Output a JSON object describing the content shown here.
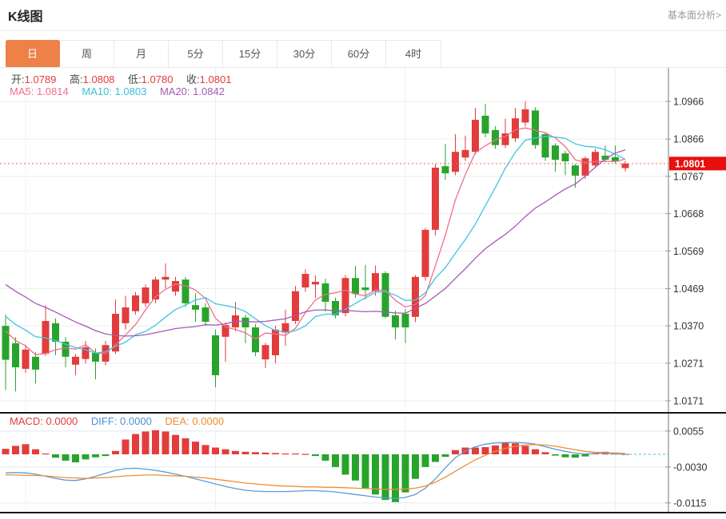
{
  "header": {
    "title": "K线图",
    "link_label": "基本面分析>"
  },
  "tabs": {
    "active_index": 0,
    "items": [
      "日",
      "周",
      "月",
      "5分",
      "15分",
      "30分",
      "60分",
      "4时"
    ]
  },
  "readout": {
    "open_label": "开:",
    "open": "1.0789",
    "high_label": "高:",
    "high": "1.0808",
    "low_label": "低:",
    "low": "1.0780",
    "close_label": "收:",
    "close": "1.0801",
    "ma5_label": "MA5:",
    "ma5": "1.0814",
    "ma10_label": "MA10:",
    "ma10": "1.0803",
    "ma20_label": "MA20:",
    "ma20": "1.0842"
  },
  "macd_readout": {
    "macd_label": "MACD:",
    "macd": "0.0000",
    "diff_label": "DIFF:",
    "diff": "0.0000",
    "dea_label": "DEA:",
    "dea": "0.0000"
  },
  "colors": {
    "accent_orange": "#ee8147",
    "up_red": "#e23c3c",
    "down_green": "#28a42c",
    "ma5_pink": "#f06d8c",
    "ma10_cyan": "#3ec6dd",
    "ma20_purple": "#a55ab4",
    "diff_blue": "#5b9bd8",
    "dea_orange": "#ee8f33",
    "price_badge_red": "#e80f0f",
    "grid": "#ededed",
    "macd_grid": "#dfeaf2",
    "axis_text": "#333333"
  },
  "chart_data": {
    "type": "candlestick+macd",
    "main": {
      "y_axis": [
        "1.0966",
        "1.0866",
        "1.0767",
        "1.0668",
        "1.0569",
        "1.0469",
        "1.0370",
        "1.0271",
        "1.0171"
      ],
      "current_price": 1.0801,
      "current_price_label": "1.0801",
      "time_gridline_indices": [
        2,
        21,
        40,
        61
      ],
      "ma_lines": [
        {
          "period": 5,
          "color": "#f06d8c"
        },
        {
          "period": 10,
          "color": "#3ec6dd"
        },
        {
          "period": 20,
          "color": "#a55ab4"
        }
      ],
      "ma_seed_closes": [
        1.062,
        1.0615,
        1.061,
        1.06,
        1.059,
        1.0575,
        1.056,
        1.0545,
        1.053,
        1.0515,
        1.0498,
        1.0478,
        1.0455,
        1.0432,
        1.0412,
        1.0396,
        1.0385,
        1.0378,
        1.0372,
        1.0366
      ],
      "candles_ohlc": [
        [
          1.037,
          1.04,
          1.02,
          1.028
        ],
        [
          1.0324,
          1.034,
          1.0196,
          1.026
        ],
        [
          1.0256,
          1.032,
          1.0245,
          1.0307
        ],
        [
          1.0288,
          1.03,
          1.0217,
          1.0254
        ],
        [
          1.0296,
          1.0425,
          1.029,
          1.0383
        ],
        [
          1.0377,
          1.039,
          1.0292,
          1.0328
        ],
        [
          1.0328,
          1.034,
          1.026,
          1.0288
        ],
        [
          1.0267,
          1.0295,
          1.0239,
          1.0288
        ],
        [
          1.0282,
          1.033,
          1.027,
          1.0313
        ],
        [
          1.0298,
          1.031,
          1.0228,
          1.0275
        ],
        [
          1.0275,
          1.033,
          1.0265,
          1.0319
        ],
        [
          1.0302,
          1.044,
          1.0295,
          1.0402
        ],
        [
          1.0377,
          1.045,
          1.036,
          1.0419
        ],
        [
          1.0409,
          1.046,
          1.04,
          1.0451
        ],
        [
          1.043,
          1.048,
          1.042,
          1.0472
        ],
        [
          1.044,
          1.05,
          1.043,
          1.0493
        ],
        [
          1.0493,
          1.0536,
          1.047,
          1.05
        ],
        [
          1.0461,
          1.05,
          1.045,
          1.0489
        ],
        [
          1.0493,
          1.05,
          1.042,
          1.043
        ],
        [
          1.0425,
          1.0457,
          1.0381,
          1.0413
        ],
        [
          1.0419,
          1.043,
          1.037,
          1.0381
        ],
        [
          1.0345,
          1.036,
          1.0207,
          1.0239
        ],
        [
          1.0341,
          1.038,
          1.0275,
          1.0372
        ],
        [
          1.0366,
          1.0434,
          1.0355,
          1.0398
        ],
        [
          1.0392,
          1.04,
          1.0324,
          1.0366
        ],
        [
          1.0366,
          1.0375,
          1.029,
          1.03
        ],
        [
          1.0281,
          1.0325,
          1.0258,
          1.0319
        ],
        [
          1.0292,
          1.037,
          1.0271,
          1.036
        ],
        [
          1.0352,
          1.0413,
          1.0317,
          1.0377
        ],
        [
          1.0383,
          1.0476,
          1.0375,
          1.0462
        ],
        [
          1.0472,
          1.052,
          1.046,
          1.0508
        ],
        [
          1.048,
          1.0504,
          1.0444,
          1.0487
        ],
        [
          1.0483,
          1.0495,
          1.0408,
          1.0434
        ],
        [
          1.0436,
          1.0445,
          1.039,
          1.0398
        ],
        [
          1.0404,
          1.0505,
          1.0395,
          1.0497
        ],
        [
          1.0497,
          1.0529,
          1.0445,
          1.0455
        ],
        [
          1.0472,
          1.0532,
          1.044,
          1.0465
        ],
        [
          1.0462,
          1.053,
          1.045,
          1.051
        ],
        [
          1.051,
          1.0515,
          1.039,
          1.0394
        ],
        [
          1.0398,
          1.041,
          1.0334,
          1.0366
        ],
        [
          1.0402,
          1.0415,
          1.0324,
          1.0366
        ],
        [
          1.0394,
          1.0505,
          1.038,
          1.05
        ],
        [
          1.05,
          1.063,
          1.049,
          1.0625
        ],
        [
          1.0625,
          1.08,
          1.061,
          1.079
        ],
        [
          1.0794,
          1.0854,
          1.0758,
          1.0775
        ],
        [
          1.0779,
          1.0879,
          1.077,
          1.0832
        ],
        [
          1.0817,
          1.0875,
          1.0808,
          1.0837
        ],
        [
          1.0832,
          1.0949,
          1.0825,
          1.0917
        ],
        [
          1.0928,
          1.096,
          1.087,
          1.0881
        ],
        [
          1.089,
          1.09,
          1.084,
          1.085
        ],
        [
          1.085,
          1.092,
          1.0842,
          1.0881
        ],
        [
          1.0868,
          1.0949,
          1.0858,
          1.0921
        ],
        [
          1.091,
          1.0966,
          1.09,
          1.0945
        ],
        [
          1.0942,
          1.095,
          1.084,
          1.085
        ],
        [
          1.0879,
          1.0885,
          1.0808,
          1.0817
        ],
        [
          1.0849,
          1.0855,
          1.078,
          1.0811
        ],
        [
          1.0828,
          1.0835,
          1.077,
          1.0807
        ],
        [
          1.0796,
          1.08,
          1.0737,
          1.0769
        ],
        [
          1.0769,
          1.082,
          1.076,
          1.0815
        ],
        [
          1.0796,
          1.084,
          1.079,
          1.0832
        ],
        [
          1.0822,
          1.0849,
          1.0805,
          1.0811
        ],
        [
          1.0818,
          1.0849,
          1.08,
          1.0806
        ],
        [
          1.0789,
          1.0808,
          1.078,
          1.0801
        ]
      ]
    },
    "macd": {
      "y_axis": [
        "0.0055",
        "-0.0030",
        "-0.0115"
      ],
      "histogram": [
        0.0013,
        0.002,
        0.0024,
        0.0012,
        0.0002,
        -0.0008,
        -0.0015,
        -0.0019,
        -0.0012,
        -0.0007,
        -0.0004,
        0.0008,
        0.0035,
        0.0048,
        0.0054,
        0.0057,
        0.0054,
        0.0046,
        0.0038,
        0.003,
        0.0022,
        0.0016,
        0.0012,
        0.0008,
        0.0006,
        0.0005,
        0.0004,
        0.0003,
        0.0002,
        0.0002,
        0.0001,
        -0.0004,
        -0.0015,
        -0.003,
        -0.0048,
        -0.0062,
        -0.008,
        -0.0095,
        -0.0108,
        -0.0113,
        -0.009,
        -0.0058,
        -0.003,
        -0.0018,
        -0.0006,
        0.001,
        0.0016,
        0.0016,
        0.0017,
        0.0021,
        0.0028,
        0.0026,
        0.002,
        0.0012,
        0.0005,
        -0.0003,
        -0.0007,
        -0.0008,
        -0.0005,
        0.0003,
        0.0006,
        0.0004,
        0.0001
      ],
      "diff": [
        -0.0044,
        -0.0043,
        -0.0044,
        -0.0047,
        -0.0052,
        -0.0057,
        -0.0061,
        -0.0062,
        -0.0058,
        -0.0052,
        -0.0045,
        -0.0038,
        -0.0034,
        -0.0033,
        -0.0035,
        -0.0038,
        -0.0042,
        -0.0047,
        -0.0052,
        -0.0058,
        -0.0064,
        -0.007,
        -0.0076,
        -0.0081,
        -0.0085,
        -0.0087,
        -0.0088,
        -0.0088,
        -0.0088,
        -0.0087,
        -0.0086,
        -0.0086,
        -0.0087,
        -0.0089,
        -0.0092,
        -0.0095,
        -0.0098,
        -0.0101,
        -0.0103,
        -0.0104,
        -0.0102,
        -0.0095,
        -0.008,
        -0.0058,
        -0.0032,
        -0.0008,
        0.0008,
        0.0018,
        0.0024,
        0.0027,
        0.0028,
        0.0028,
        0.0027,
        0.0024,
        0.0018,
        0.0012,
        0.0007,
        0.0003,
        0.0001,
        0.0002,
        0.0003,
        0.0002,
        0.0001
      ],
      "dea": [
        -0.0049,
        -0.0049,
        -0.005,
        -0.005,
        -0.0051,
        -0.0053,
        -0.0055,
        -0.0056,
        -0.0057,
        -0.0056,
        -0.0055,
        -0.0053,
        -0.0051,
        -0.005,
        -0.0049,
        -0.0049,
        -0.005,
        -0.0051,
        -0.0052,
        -0.0054,
        -0.0056,
        -0.0059,
        -0.0062,
        -0.0065,
        -0.0068,
        -0.007,
        -0.0072,
        -0.0074,
        -0.0075,
        -0.0076,
        -0.0077,
        -0.0077,
        -0.0078,
        -0.0078,
        -0.0079,
        -0.008,
        -0.0081,
        -0.0082,
        -0.0083,
        -0.0083,
        -0.0082,
        -0.008,
        -0.0075,
        -0.0066,
        -0.0054,
        -0.004,
        -0.0026,
        -0.0013,
        -0.0002,
        0.0007,
        0.0014,
        0.0019,
        0.0022,
        0.0023,
        0.0022,
        0.0019,
        0.0015,
        0.0011,
        0.0007,
        0.0005,
        0.0004,
        0.0003,
        0.0002
      ]
    }
  }
}
